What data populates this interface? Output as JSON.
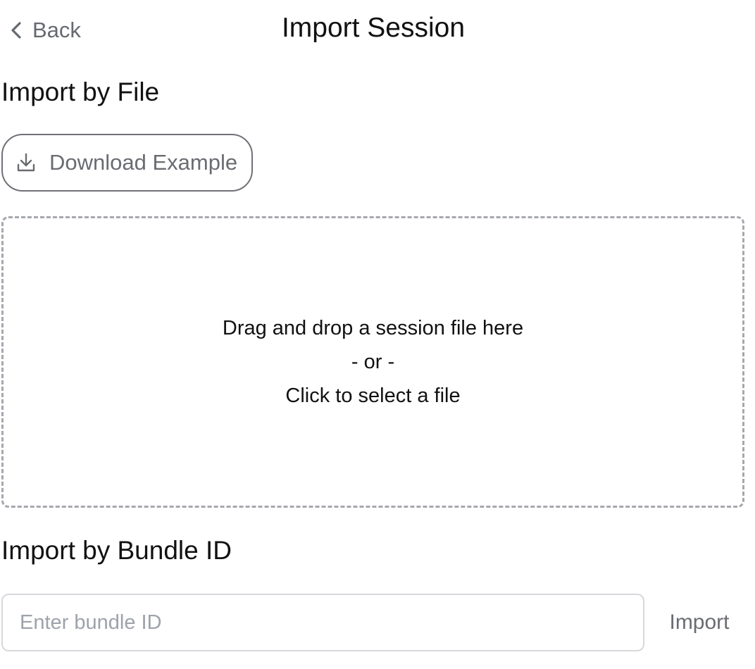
{
  "header": {
    "back_label": "Back",
    "title": "Import Session",
    "back_icon": "chevron-left-icon"
  },
  "file_section": {
    "title": "Import by File",
    "download_button": {
      "label": "Download Example",
      "icon": "download-icon"
    },
    "dropzone": {
      "line1": "Drag and drop a session file here",
      "line2": "- or -",
      "line3": "Click to select a file"
    }
  },
  "bundle_section": {
    "title": "Import by Bundle ID",
    "input": {
      "value": "",
      "placeholder": "Enter bundle ID"
    },
    "import_label": "Import"
  },
  "colors": {
    "text": "#111111",
    "muted_text": "#6a6c72",
    "placeholder": "#9ea2aa",
    "dropzone_border": "#a6a8ae",
    "button_border": "#6f7177",
    "input_border": "#d7d8dc"
  }
}
